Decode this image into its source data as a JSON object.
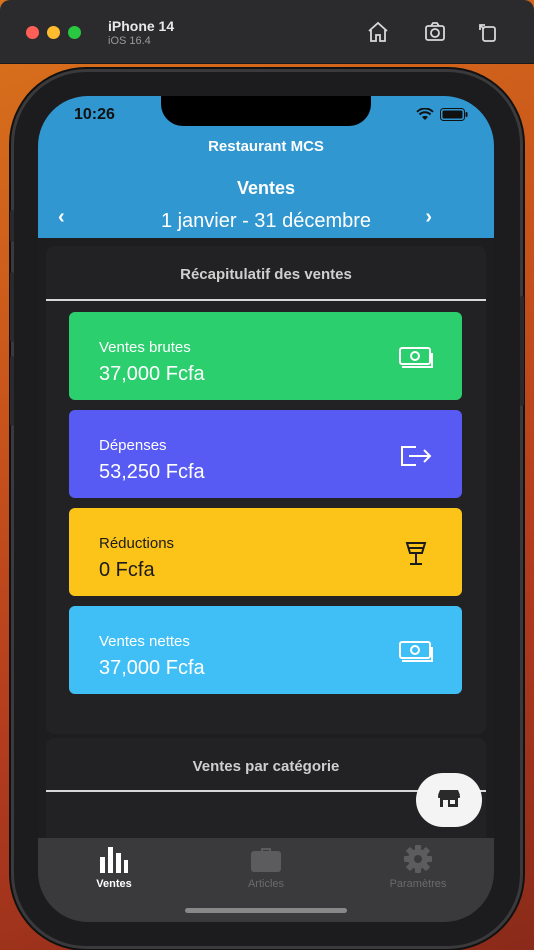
{
  "simulator": {
    "device": "iPhone 14",
    "os": "iOS 16.4"
  },
  "status_bar": {
    "time": "10:26"
  },
  "header": {
    "restaurant": "Restaurant MCS",
    "title": "Ventes",
    "date_range": "1 janvier - 31 décembre",
    "prev_label": "‹",
    "next_label": "›"
  },
  "summary": {
    "title": "Récapitulatif des ventes",
    "cards": [
      {
        "label": "Ventes brutes",
        "value": "37,000 Fcfa",
        "color": "#2bcf6e",
        "icon": "cash-icon"
      },
      {
        "label": "Dépenses",
        "value": "53,250 Fcfa",
        "color": "#575af3",
        "icon": "exit-icon"
      },
      {
        "label": "Réductions",
        "value": "0 Fcfa",
        "color": "#fcc419",
        "icon": "glass-icon"
      },
      {
        "label": "Ventes nettes",
        "value": "37,000 Fcfa",
        "color": "#3fbff5",
        "icon": "cash-icon"
      }
    ]
  },
  "category": {
    "title": "Ventes par catégorie"
  },
  "tabs": [
    {
      "label": "Ventes",
      "icon": "bar-chart-icon",
      "active": true
    },
    {
      "label": "Articles",
      "icon": "briefcase-icon",
      "active": false
    },
    {
      "label": "Paramètres",
      "icon": "gear-icon",
      "active": false
    }
  ],
  "colors": {
    "header": "#3097d1",
    "background": "#1d1d1f",
    "panel": "#222224",
    "tabbar": "#3a3a3c"
  }
}
